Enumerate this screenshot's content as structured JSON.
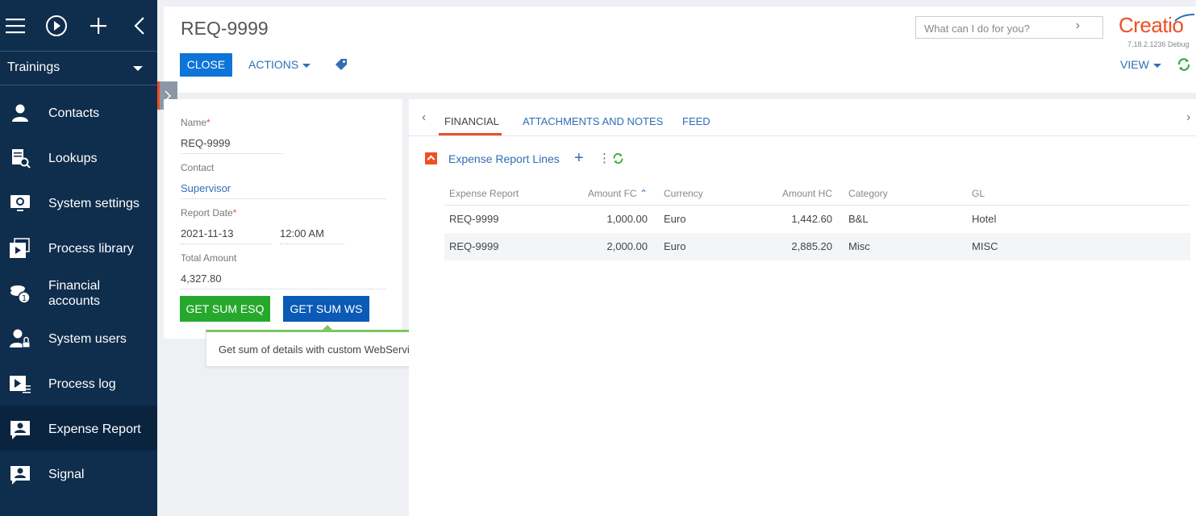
{
  "sidebar": {
    "workspace": "Trainings",
    "items": [
      {
        "label": "Contacts",
        "icon": "contact-icon"
      },
      {
        "label": "Lookups",
        "icon": "lookup-icon"
      },
      {
        "label": "System settings",
        "icon": "settings-icon"
      },
      {
        "label": "Process library",
        "icon": "process-library-icon"
      },
      {
        "label": "Financial accounts",
        "icon": "coins-icon"
      },
      {
        "label": "System users",
        "icon": "user-lock-icon"
      },
      {
        "label": "Process log",
        "icon": "process-log-icon"
      },
      {
        "label": "Expense Report",
        "icon": "card-icon"
      },
      {
        "label": "Signal",
        "icon": "card-icon"
      }
    ]
  },
  "header": {
    "title": "REQ-9999",
    "close_label": "CLOSE",
    "actions_label": "ACTIONS",
    "search_placeholder": "What can I do for you?",
    "logo": "Creatio",
    "version": "7.18.2.1236 Debug",
    "view_label": "VIEW"
  },
  "form": {
    "name_label": "Name",
    "name_value": "REQ-9999",
    "contact_label": "Contact",
    "contact_value": "Supervisor",
    "report_date_label": "Report Date",
    "date_value": "2021-11-13",
    "time_value": "12:00 AM",
    "total_label": "Total Amount",
    "total_value": "4,327.80",
    "btn_esq": "GET SUM ESQ",
    "btn_ws": "GET SUM WS",
    "tooltip": "Get sum of details with custom WebService"
  },
  "tabs": [
    "FINANCIAL",
    "ATTACHMENTS AND NOTES",
    "FEED"
  ],
  "detail": {
    "title": "Expense Report Lines",
    "columns": [
      "Expense Report",
      "Amount FC",
      "Currency",
      "Amount HC",
      "Category",
      "GL"
    ],
    "rows": [
      [
        "REQ-9999",
        "1,000.00",
        "Euro",
        "1,442.60",
        "B&L",
        "Hotel"
      ],
      [
        "REQ-9999",
        "2,000.00",
        "Euro",
        "2,885.20",
        "Misc",
        "MISC"
      ]
    ]
  },
  "colors": {
    "sidebar_bg": "#0f2d4c",
    "primary": "#0e74d8",
    "green": "#26a82c",
    "accent": "#f04e23"
  }
}
